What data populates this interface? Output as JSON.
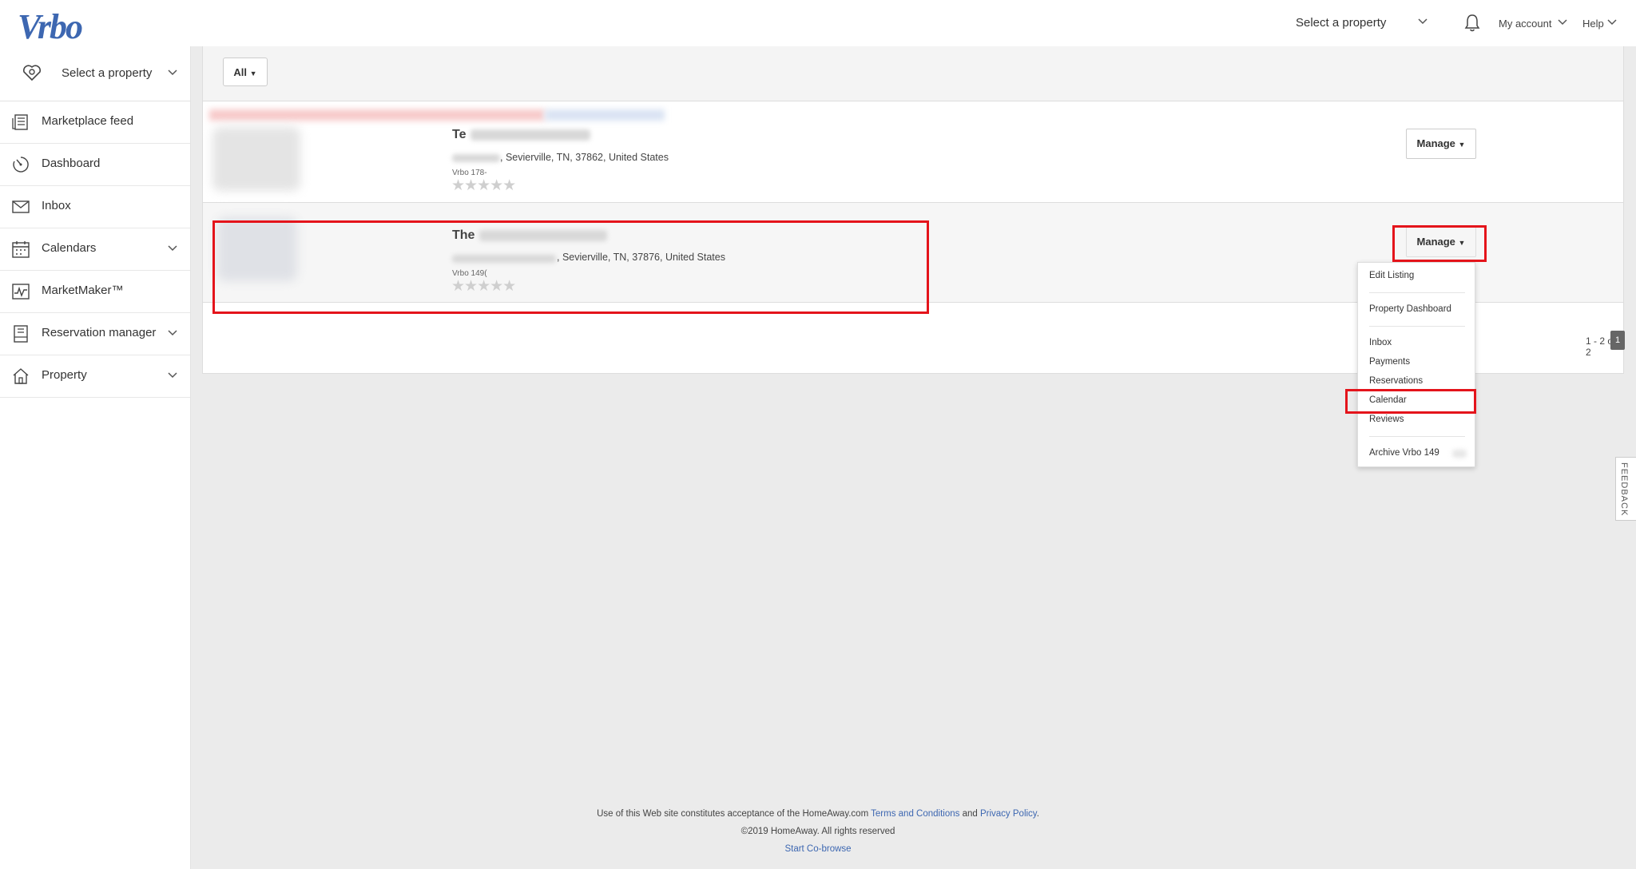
{
  "header": {
    "logo": "Vrbo",
    "select_property": "Select a property",
    "my_account": "My account",
    "help": "Help"
  },
  "sidebar": {
    "select_property": "Select a property",
    "items": [
      {
        "label": "Marketplace feed",
        "icon": "feed-icon"
      },
      {
        "label": "Dashboard",
        "icon": "dashboard-icon"
      },
      {
        "label": "Inbox",
        "icon": "envelope-icon"
      },
      {
        "label": "Calendars",
        "icon": "calendar-icon"
      },
      {
        "label": "MarketMaker™",
        "icon": "chart-line-icon"
      },
      {
        "label": "Reservation manager",
        "icon": "book-icon"
      },
      {
        "label": "Property",
        "icon": "house-icon"
      }
    ]
  },
  "filter": {
    "label": "All"
  },
  "properties": [
    {
      "title": "Te",
      "address": ", Sevierville, TN, 37862, United States",
      "vrbo_id": "Vrbo 178-",
      "stars": "★★★★★",
      "manage_label": "Manage"
    },
    {
      "title": "The",
      "address": ", Sevierville, TN, 37876, United States",
      "vrbo_id": "Vrbo 149(",
      "stars": "★★★★★",
      "manage_label": "Manage"
    }
  ],
  "dropdown": {
    "items": [
      "Edit Listing",
      "Property Dashboard",
      "Inbox",
      "Payments",
      "Reservations",
      "Calendar",
      "Reviews",
      "Archive Vrbo 149"
    ]
  },
  "pagination": {
    "range": "1 - 2 of 2",
    "page": "1"
  },
  "feedback": "FEEDBACK",
  "footer": {
    "text_prefix": "Use of this Web site constitutes acceptance of the HomeAway.com",
    "terms": "Terms and Conditions",
    "and": "and",
    "privacy": "Privacy Policy",
    "period": ".",
    "copyright": "©2019 HomeAway. All rights reserved",
    "cobrowse": "Start Co-browse"
  },
  "colors": {
    "brand": "#3d67b1",
    "highlight": "#e4141b",
    "background": "#ebebeb"
  }
}
